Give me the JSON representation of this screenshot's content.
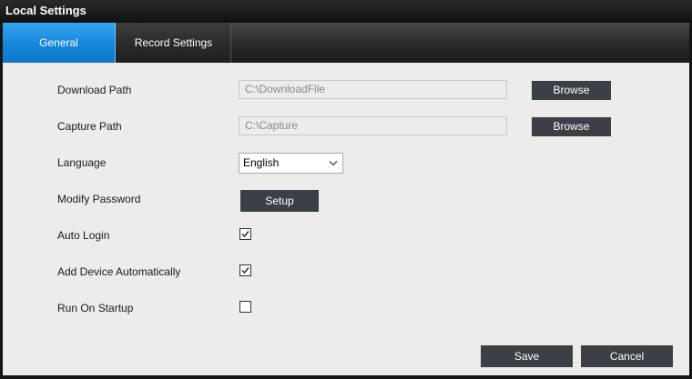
{
  "window": {
    "title": "Local Settings"
  },
  "tabs": [
    {
      "label": "General",
      "active": true
    },
    {
      "label": "Record Settings",
      "active": false
    }
  ],
  "form": {
    "download_path": {
      "label": "Download Path",
      "value": "C:\\DownloadFile",
      "browse_label": "Browse"
    },
    "capture_path": {
      "label": "Capture Path",
      "value": "C:\\Capture",
      "browse_label": "Browse"
    },
    "language": {
      "label": "Language",
      "selected": "English"
    },
    "modify_password": {
      "label": "Modify Password",
      "button_label": "Setup"
    },
    "auto_login": {
      "label": "Auto Login",
      "checked": true
    },
    "add_device_automatically": {
      "label": "Add Device Automatically",
      "checked": true
    },
    "run_on_startup": {
      "label": "Run On Startup",
      "checked": false
    }
  },
  "footer": {
    "save_label": "Save",
    "cancel_label": "Cancel"
  },
  "colors": {
    "accent_tab": "#1587db",
    "button_bg": "#3b4047",
    "panel_bg": "#ececec",
    "frame_bg": "#141414"
  },
  "icons": {
    "checkmark": "check-icon",
    "dropdown": "chevron-down-icon"
  }
}
